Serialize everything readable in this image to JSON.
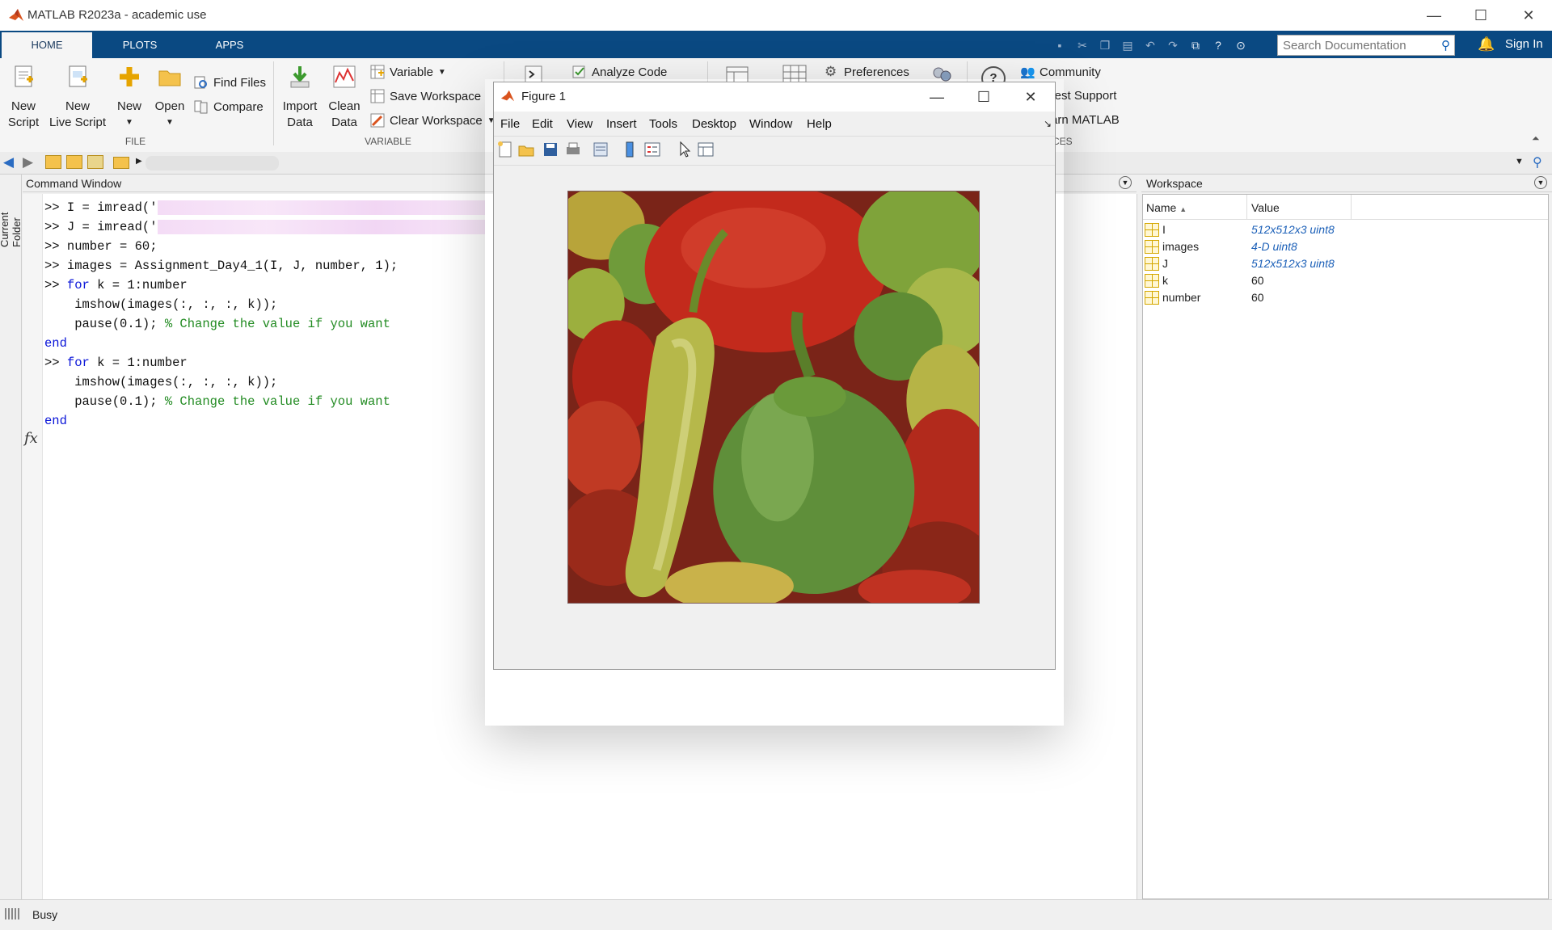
{
  "window": {
    "title": "MATLAB R2023a - academic use"
  },
  "ribbon_tabs": [
    "HOME",
    "PLOTS",
    "APPS"
  ],
  "search": {
    "placeholder": "Search Documentation"
  },
  "signin_label": "Sign In",
  "file_group": {
    "new_script": "New\nScript",
    "new_live_script": "New\nLive Script",
    "new": "New",
    "open": "Open",
    "find_files": "Find Files",
    "compare": "Compare",
    "label": "FILE"
  },
  "variable_group": {
    "import_data": "Import\nData",
    "clean_data": "Clean\nData",
    "variable": "Variable",
    "save_workspace": "Save Workspace",
    "clear_workspace": "Clear Workspace",
    "label": "VARIABLE"
  },
  "code_group": {
    "analyze_code": "Analyze Code"
  },
  "env_group": {
    "preferences": "Preferences"
  },
  "resources_group": {
    "community": "Community",
    "request_support": "quest Support",
    "learn_matlab": "arn MATLAB",
    "label": "RCES"
  },
  "current_folder_label": "Current Folder",
  "command_window": {
    "title": "Command Window",
    "lines": [
      ">> I = imread('",
      ">> J = imread('",
      ">> number = 60;",
      ">> images = Assignment_Day4_1(I, J, number, 1);",
      ">> ",
      "for",
      " k = 1:number",
      "    imshow(images(:, :, :, k));",
      "    pause(0.1); ",
      "% Change the value if you want",
      "end"
    ]
  },
  "workspace": {
    "title": "Workspace",
    "columns": [
      "Name",
      "Value"
    ],
    "rows": [
      {
        "name": "I",
        "value": "512x512x3 uint8",
        "type": "link"
      },
      {
        "name": "images",
        "value": "4-D uint8",
        "type": "link"
      },
      {
        "name": "J",
        "value": "512x512x3 uint8",
        "type": "link"
      },
      {
        "name": "k",
        "value": "60",
        "type": "plain"
      },
      {
        "name": "number",
        "value": "60",
        "type": "plain"
      }
    ]
  },
  "status": {
    "text": "Busy"
  },
  "figure": {
    "title": "Figure 1",
    "menus": [
      "File",
      "Edit",
      "View",
      "Insert",
      "Tools",
      "Desktop",
      "Window",
      "Help"
    ]
  },
  "colors": {
    "ribbon_blue": "#0a4982",
    "keyword": "#0a15d8",
    "comment": "#228b22",
    "link": "#1c60b8"
  }
}
